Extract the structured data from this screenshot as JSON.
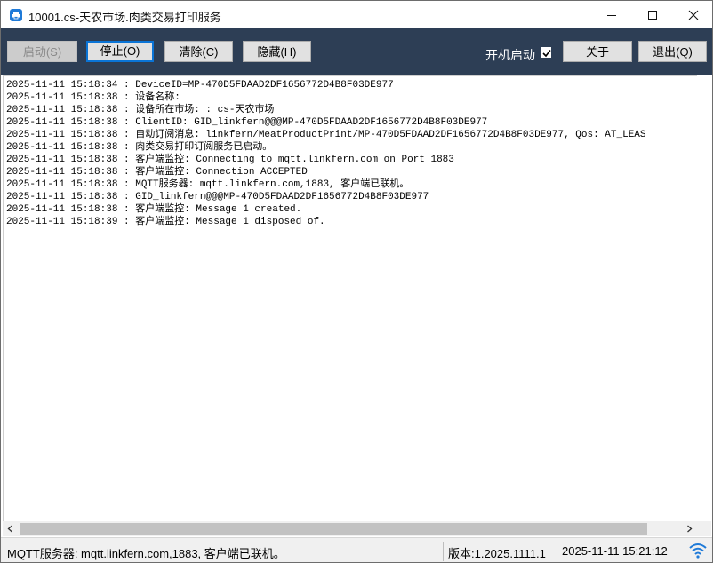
{
  "window": {
    "title": "10001.cs-天农市场.肉类交易打印服务"
  },
  "toolbar": {
    "start_label": "启动(S)",
    "stop_label": "停止(O)",
    "clear_label": "清除(C)",
    "hide_label": "隐藏(H)",
    "autostart_label": "开机启动",
    "autostart_checked": true,
    "about_label": "关于",
    "exit_label": "退出(Q)"
  },
  "log": {
    "lines": [
      "2025-11-11 15:18:34 : DeviceID=MP-470D5FDAAD2DF1656772D4B8F03DE977",
      "2025-11-11 15:18:38 : 设备名称:",
      "2025-11-11 15:18:38 : 设备所在市场: : cs-天农市场",
      "2025-11-11 15:18:38 : ClientID: GID_linkfern@@@MP-470D5FDAAD2DF1656772D4B8F03DE977",
      "2025-11-11 15:18:38 : 自动订阅消息: linkfern/MeatProductPrint/MP-470D5FDAAD2DF1656772D4B8F03DE977, Qos: AT_LEAS",
      "2025-11-11 15:18:38 : 肉类交易打印订阅服务已启动。",
      "2025-11-11 15:18:38 : 客户端监控: Connecting to mqtt.linkfern.com on Port 1883",
      "2025-11-11 15:18:38 : 客户端监控: Connection ACCEPTED",
      "2025-11-11 15:18:38 : MQTT服务器: mqtt.linkfern.com,1883, 客户端已联机。",
      "2025-11-11 15:18:38 : GID_linkfern@@@MP-470D5FDAAD2DF1656772D4B8F03DE977",
      "2025-11-11 15:18:38 : 客户端监控: Message 1 created.",
      "2025-11-11 15:18:39 : 客户端监控: Message 1 disposed of."
    ]
  },
  "statusbar": {
    "server": "MQTT服务器: mqtt.linkfern.com,1883, 客户端已联机。",
    "version": "版本:1.2025.1111.1",
    "datetime": "2025-11-11 15:21:12"
  },
  "colors": {
    "toolbar_bg": "#2d3e55",
    "focus_border": "#0a74d6",
    "wifi": "#1f7ad8"
  },
  "icons": {
    "app": "printer-app-icon",
    "network": "wifi-icon"
  }
}
